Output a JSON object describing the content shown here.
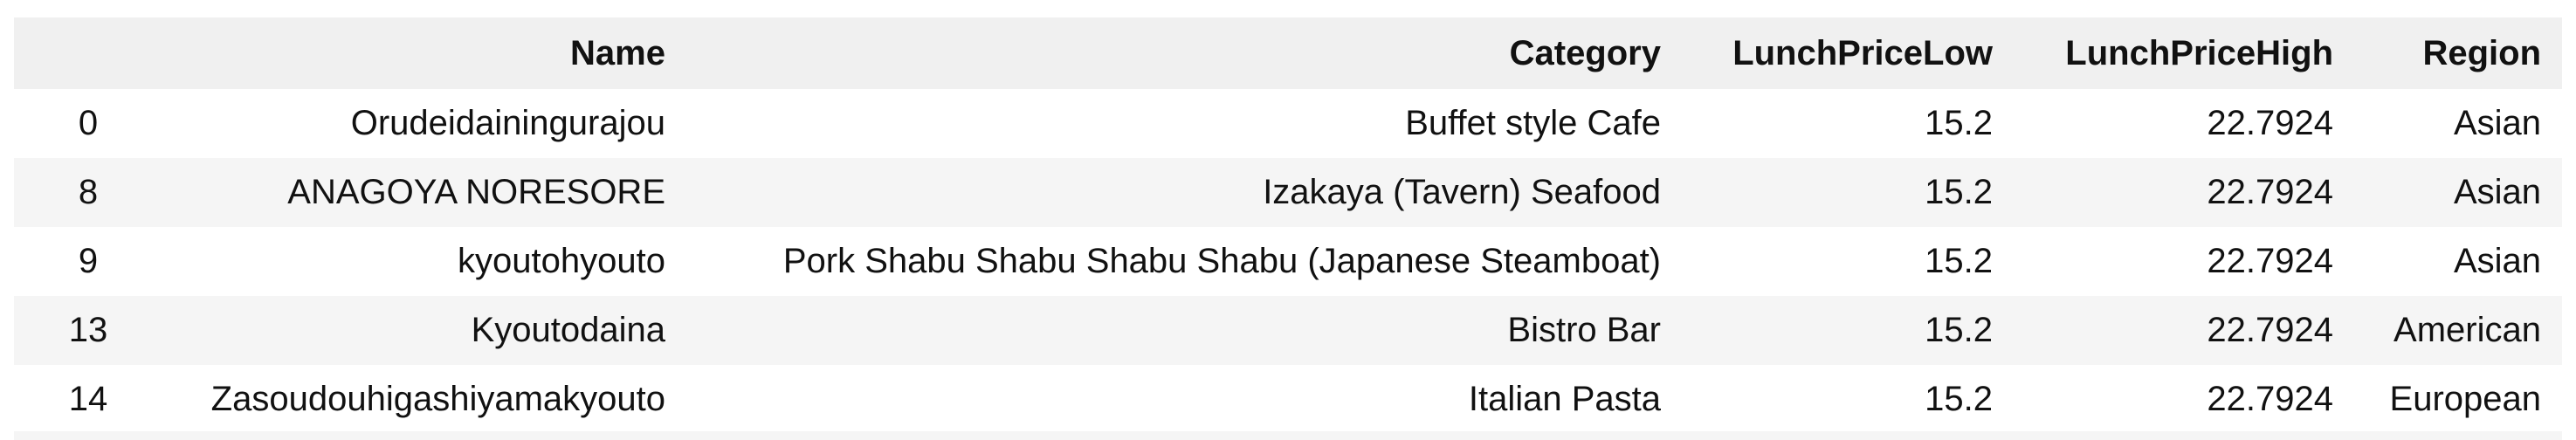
{
  "table": {
    "columns": [
      "",
      "Name",
      "Category",
      "LunchPriceLow",
      "LunchPriceHigh",
      "Region"
    ],
    "rows": [
      {
        "index": "0",
        "name": "Orudeidainingurajou",
        "category": "Buffet style Cafe",
        "low": "15.2",
        "high": "22.7924",
        "region": "Asian"
      },
      {
        "index": "8",
        "name": "ANAGOYA NORESORE",
        "category": "Izakaya (Tavern) Seafood",
        "low": "15.2",
        "high": "22.7924",
        "region": "Asian"
      },
      {
        "index": "9",
        "name": "kyoutohyouto",
        "category": "Pork Shabu Shabu Shabu Shabu (Japanese Steamboat)",
        "low": "15.2",
        "high": "22.7924",
        "region": "Asian"
      },
      {
        "index": "13",
        "name": "Kyoutodaina",
        "category": "Bistro Bar",
        "low": "15.2",
        "high": "22.7924",
        "region": "American"
      },
      {
        "index": "14",
        "name": "Zasoudouhigashiyamakyouto",
        "category": "Italian Pasta",
        "low": "15.2",
        "high": "22.7924",
        "region": "European"
      }
    ]
  }
}
